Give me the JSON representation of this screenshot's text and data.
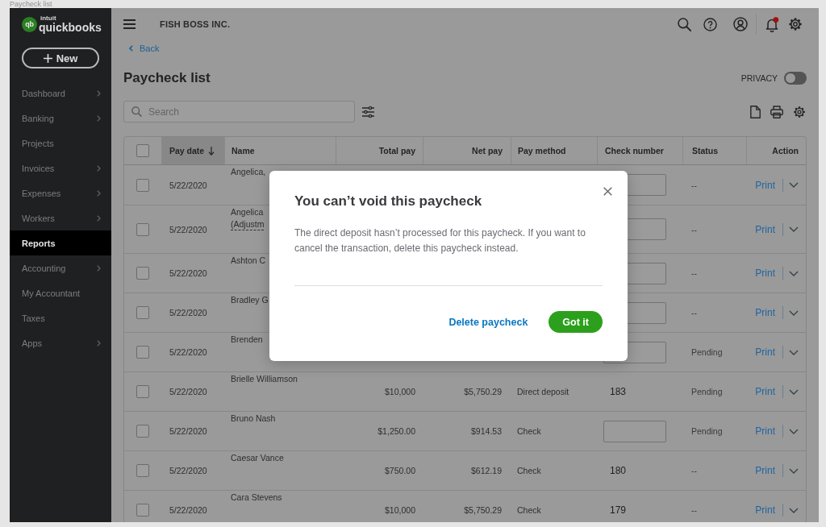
{
  "window": {
    "title": "Paycheck list"
  },
  "sidebar": {
    "logo": {
      "mark": "qb",
      "maker": "intuit",
      "name": "quickbooks"
    },
    "new_button": "New",
    "items": [
      {
        "label": "Dashboard",
        "submenu": true,
        "selected": false
      },
      {
        "label": "Banking",
        "submenu": true,
        "selected": false
      },
      {
        "label": "Projects",
        "submenu": false,
        "selected": false
      },
      {
        "label": "Invoices",
        "submenu": true,
        "selected": false
      },
      {
        "label": "Expenses",
        "submenu": true,
        "selected": false
      },
      {
        "label": "Workers",
        "submenu": true,
        "selected": false
      },
      {
        "label": "Reports",
        "submenu": false,
        "selected": true
      },
      {
        "label": "Accounting",
        "submenu": true,
        "selected": false
      },
      {
        "label": "My Accountant",
        "submenu": false,
        "selected": false
      },
      {
        "label": "Taxes",
        "submenu": false,
        "selected": false
      },
      {
        "label": "Apps",
        "submenu": true,
        "selected": false
      }
    ]
  },
  "topbar": {
    "company": "FISH BOSS INC.",
    "notification": true
  },
  "page": {
    "back": "Back",
    "title": "Paycheck list",
    "privacy": {
      "label": "PRIVACY",
      "on": false
    },
    "search": {
      "placeholder": "Search"
    }
  },
  "table": {
    "select_all": {
      "checked": false
    },
    "columns": [
      {
        "label": "Pay date",
        "sorted": true
      },
      {
        "label": "Name",
        "sorted": false
      },
      {
        "label": "Total pay",
        "sorted": false
      },
      {
        "label": "Net pay",
        "sorted": false
      },
      {
        "label": "Pay method",
        "sorted": false
      },
      {
        "label": "Check number",
        "sorted": false
      },
      {
        "label": "Status",
        "sorted": false
      },
      {
        "label": "Action",
        "sorted": false
      }
    ],
    "rows": [
      {
        "checked": false,
        "pay_date": "5/22/2020",
        "name": "Angelica,",
        "check_number": {
          "kind": "field"
        },
        "status": "--",
        "action": "Print"
      },
      {
        "checked": false,
        "pay_date": "5/22/2020",
        "name": "Angelica",
        "name_note": "(Adjustm",
        "check_number": {
          "kind": "field"
        },
        "status": "--",
        "action": "Print"
      },
      {
        "checked": false,
        "pay_date": "5/22/2020",
        "name": "Ashton C",
        "check_number": {
          "kind": "field"
        },
        "status": "--",
        "action": "Print"
      },
      {
        "checked": false,
        "pay_date": "5/22/2020",
        "name": "Bradley G",
        "check_number": {
          "kind": "field"
        },
        "status": "--",
        "action": "Print"
      },
      {
        "checked": false,
        "pay_date": "5/22/2020",
        "name": "Brenden",
        "check_number": {
          "kind": "field"
        },
        "status": "Pending",
        "action": "Print"
      },
      {
        "checked": false,
        "pay_date": "5/22/2020",
        "name": "Brielle Williamson",
        "total_pay": "$10,000",
        "net_pay": "$5,750.29",
        "pay_method": "Direct deposit",
        "check_number": {
          "kind": "text",
          "value": "183"
        },
        "status": "Pending",
        "action": "Print"
      },
      {
        "checked": false,
        "pay_date": "5/22/2020",
        "name": "Bruno Nash",
        "total_pay": "$1,250.00",
        "net_pay": "$914.53",
        "pay_method": "Check",
        "check_number": {
          "kind": "field"
        },
        "status": "Pending",
        "action": "Print"
      },
      {
        "checked": false,
        "pay_date": "5/22/2020",
        "name": "Caesar Vance",
        "total_pay": "$750.00",
        "net_pay": "$612.19",
        "pay_method": "Check",
        "check_number": {
          "kind": "text",
          "value": "180"
        },
        "status": "--",
        "action": "Print"
      },
      {
        "checked": false,
        "pay_date": "5/22/2020",
        "name": "Cara Stevens",
        "total_pay": "$10,000",
        "net_pay": "$5,750.29",
        "pay_method": "Check",
        "check_number": {
          "kind": "text",
          "value": "179"
        },
        "status": "--",
        "action": "Print"
      }
    ]
  },
  "dialog": {
    "title": "You can’t void this paycheck",
    "message": "The direct deposit hasn’t processed for this paycheck. If you want to cancel the transaction, delete this paycheck instead.",
    "buttons": [
      {
        "label": "Delete paycheck",
        "kind": "link"
      },
      {
        "label": "Got it",
        "kind": "primary"
      }
    ]
  }
}
